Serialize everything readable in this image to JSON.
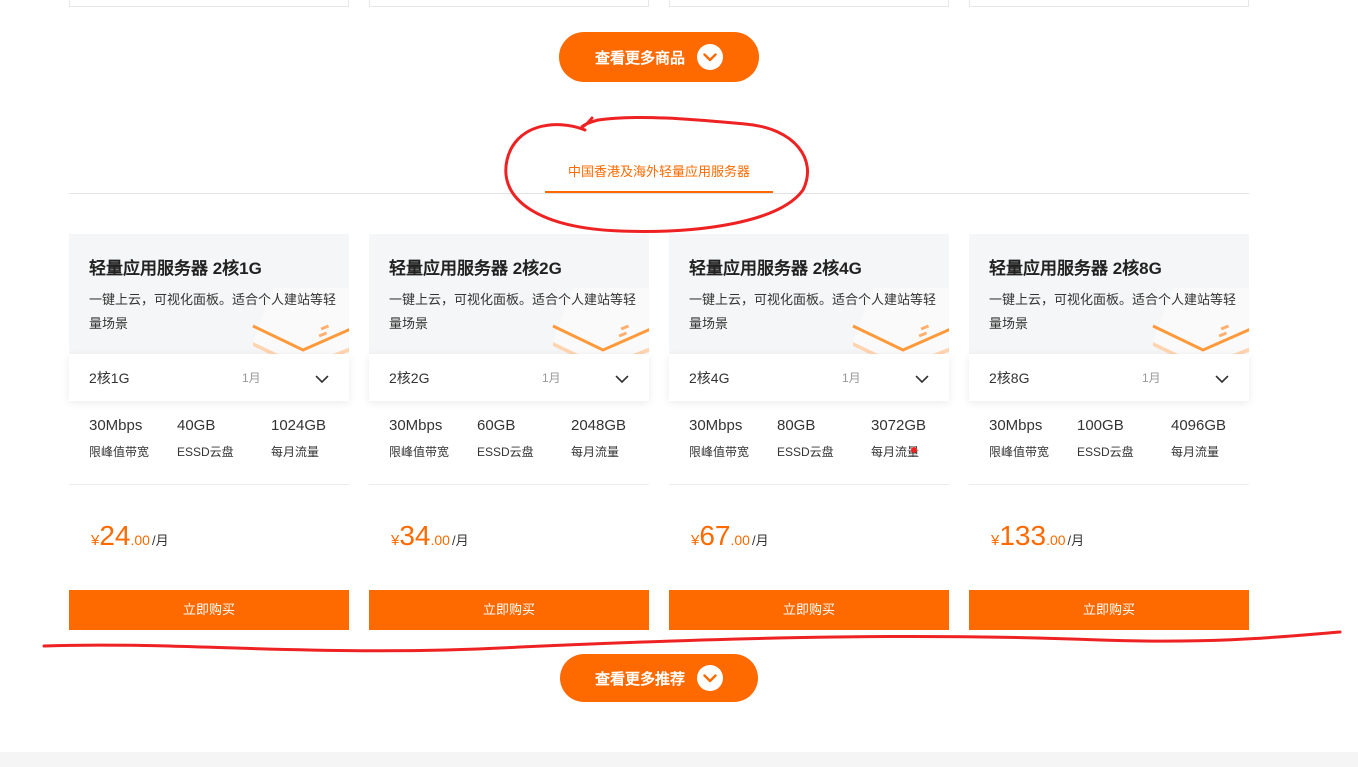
{
  "more_products_label": "查看更多商品",
  "more_recommend_label": "查看更多推荐",
  "tab_label": "中国香港及海外轻量应用服务器",
  "colors": {
    "accent": "#ff6a00",
    "annotation": "#ee2222"
  },
  "cards": [
    {
      "title": "轻量应用服务器 2核1G",
      "desc": "一键上云，可视化面板。适合个人建站等轻量场景",
      "spec": "2核1G",
      "period": "1月",
      "metrics": [
        {
          "value": "30Mbps",
          "label": "限峰值带宽"
        },
        {
          "value": "40GB",
          "label": "ESSD云盘"
        },
        {
          "value": "1024GB",
          "label": "每月流量"
        }
      ],
      "price": {
        "currency": "¥",
        "int": "24",
        "dec": ".00",
        "unit": "/月"
      },
      "buy_label": "立即购买"
    },
    {
      "title": "轻量应用服务器 2核2G",
      "desc": "一键上云，可视化面板。适合个人建站等轻量场景",
      "spec": "2核2G",
      "period": "1月",
      "metrics": [
        {
          "value": "30Mbps",
          "label": "限峰值带宽"
        },
        {
          "value": "60GB",
          "label": "ESSD云盘"
        },
        {
          "value": "2048GB",
          "label": "每月流量"
        }
      ],
      "price": {
        "currency": "¥",
        "int": "34",
        "dec": ".00",
        "unit": "/月"
      },
      "buy_label": "立即购买"
    },
    {
      "title": "轻量应用服务器 2核4G",
      "desc": "一键上云，可视化面板。适合个人建站等轻量场景",
      "spec": "2核4G",
      "period": "1月",
      "metrics": [
        {
          "value": "30Mbps",
          "label": "限峰值带宽"
        },
        {
          "value": "80GB",
          "label": "ESSD云盘"
        },
        {
          "value": "3072GB",
          "label": "每月流量"
        }
      ],
      "price": {
        "currency": "¥",
        "int": "67",
        "dec": ".00",
        "unit": "/月"
      },
      "buy_label": "立即购买"
    },
    {
      "title": "轻量应用服务器 2核8G",
      "desc": "一键上云，可视化面板。适合个人建站等轻量场景",
      "spec": "2核8G",
      "period": "1月",
      "metrics": [
        {
          "value": "30Mbps",
          "label": "限峰值带宽"
        },
        {
          "value": "100GB",
          "label": "ESSD云盘"
        },
        {
          "value": "4096GB",
          "label": "每月流量"
        }
      ],
      "price": {
        "currency": "¥",
        "int": "133",
        "dec": ".00",
        "unit": "/月"
      },
      "buy_label": "立即购买"
    }
  ]
}
